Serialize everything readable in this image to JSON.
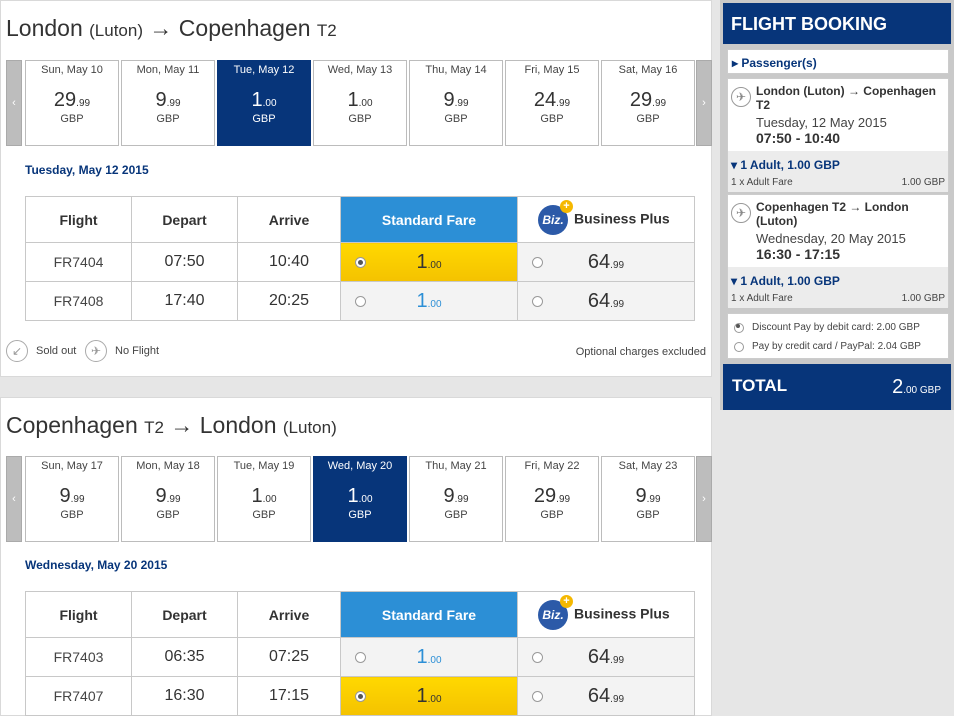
{
  "outbound": {
    "from": "London",
    "from_airport": "(Luton)",
    "arrow": "→",
    "to": "Copenhagen",
    "to_terminal": "T2",
    "days": [
      {
        "label": "Sun, May 10",
        "int": "29",
        "dec": ".99",
        "cur": "GBP",
        "selected": false
      },
      {
        "label": "Mon, May 11",
        "int": "9",
        "dec": ".99",
        "cur": "GBP",
        "selected": false
      },
      {
        "label": "Tue, May 12",
        "int": "1",
        "dec": ".00",
        "cur": "GBP",
        "selected": true
      },
      {
        "label": "Wed, May 13",
        "int": "1",
        "dec": ".00",
        "cur": "GBP",
        "selected": false
      },
      {
        "label": "Thu, May 14",
        "int": "9",
        "dec": ".99",
        "cur": "GBP",
        "selected": false
      },
      {
        "label": "Fri, May 15",
        "int": "24",
        "dec": ".99",
        "cur": "GBP",
        "selected": false
      },
      {
        "label": "Sat, May 16",
        "int": "29",
        "dec": ".99",
        "cur": "GBP",
        "selected": false
      }
    ],
    "date_heading": "Tuesday, May 12 2015",
    "headers": {
      "flight": "Flight",
      "depart": "Depart",
      "arrive": "Arrive",
      "standard": "Standard Fare",
      "biz_logo": "Biz.",
      "business": "Business Plus"
    },
    "rows": [
      {
        "flight": "FR7404",
        "depart": "07:50",
        "arrive": "10:40",
        "std_int": "1",
        "std_dec": ".00",
        "std_selected": true,
        "biz_int": "64",
        "biz_dec": ".99"
      },
      {
        "flight": "FR7408",
        "depart": "17:40",
        "arrive": "20:25",
        "std_int": "1",
        "std_dec": ".00",
        "std_selected": false,
        "biz_int": "64",
        "biz_dec": ".99"
      }
    ],
    "legend_sold_out": "Sold out",
    "legend_no_flight": "No Flight",
    "optional": "Optional charges excluded"
  },
  "inbound": {
    "from": "Copenhagen",
    "from_terminal": "T2",
    "arrow": "→",
    "to": "London",
    "to_airport": "(Luton)",
    "days": [
      {
        "label": "Sun, May 17",
        "int": "9",
        "dec": ".99",
        "cur": "GBP",
        "selected": false
      },
      {
        "label": "Mon, May 18",
        "int": "9",
        "dec": ".99",
        "cur": "GBP",
        "selected": false
      },
      {
        "label": "Tue, May 19",
        "int": "1",
        "dec": ".00",
        "cur": "GBP",
        "selected": false
      },
      {
        "label": "Wed, May 20",
        "int": "1",
        "dec": ".00",
        "cur": "GBP",
        "selected": true
      },
      {
        "label": "Thu, May 21",
        "int": "9",
        "dec": ".99",
        "cur": "GBP",
        "selected": false
      },
      {
        "label": "Fri, May 22",
        "int": "29",
        "dec": ".99",
        "cur": "GBP",
        "selected": false
      },
      {
        "label": "Sat, May 23",
        "int": "9",
        "dec": ".99",
        "cur": "GBP",
        "selected": false
      }
    ],
    "date_heading": "Wednesday, May 20 2015",
    "headers": {
      "flight": "Flight",
      "depart": "Depart",
      "arrive": "Arrive",
      "standard": "Standard Fare",
      "biz_logo": "Biz.",
      "business": "Business Plus"
    },
    "rows": [
      {
        "flight": "FR7403",
        "depart": "06:35",
        "arrive": "07:25",
        "std_int": "1",
        "std_dec": ".00",
        "std_selected": false,
        "biz_int": "64",
        "biz_dec": ".99"
      },
      {
        "flight": "FR7407",
        "depart": "16:30",
        "arrive": "17:15",
        "std_int": "1",
        "std_dec": ".00",
        "std_selected": true,
        "biz_int": "64",
        "biz_dec": ".99"
      }
    ]
  },
  "sidebar": {
    "title": "FLIGHT BOOKING",
    "passengers": "▸ Passenger(s)",
    "legs": [
      {
        "route": "London (Luton) → Copenhagen T2",
        "date": "Tuesday, 12 May 2015",
        "time": "07:50 - 10:40",
        "adult": "▾ 1 Adult, 1.00 GBP",
        "adult_line": "1 x Adult Fare",
        "adult_price": "1.00 GBP"
      },
      {
        "route": "Copenhagen T2 → London (Luton)",
        "date": "Wednesday, 20 May 2015",
        "time": "16:30 - 17:15",
        "adult": "▾ 1 Adult, 1.00 GBP",
        "adult_line": "1 x Adult Fare",
        "adult_price": "1.00 GBP"
      }
    ],
    "pay_debit": "Discount Pay by debit card: 2.00 GBP",
    "pay_credit": "Pay by credit card / PayPal: 2.04 GBP",
    "total_label": "TOTAL",
    "total_int": "2",
    "total_dec": ".00 GBP"
  },
  "colors": {
    "brand": "#07357a",
    "standard": "#2c8fd6",
    "selected_fare": "#ffd800"
  }
}
